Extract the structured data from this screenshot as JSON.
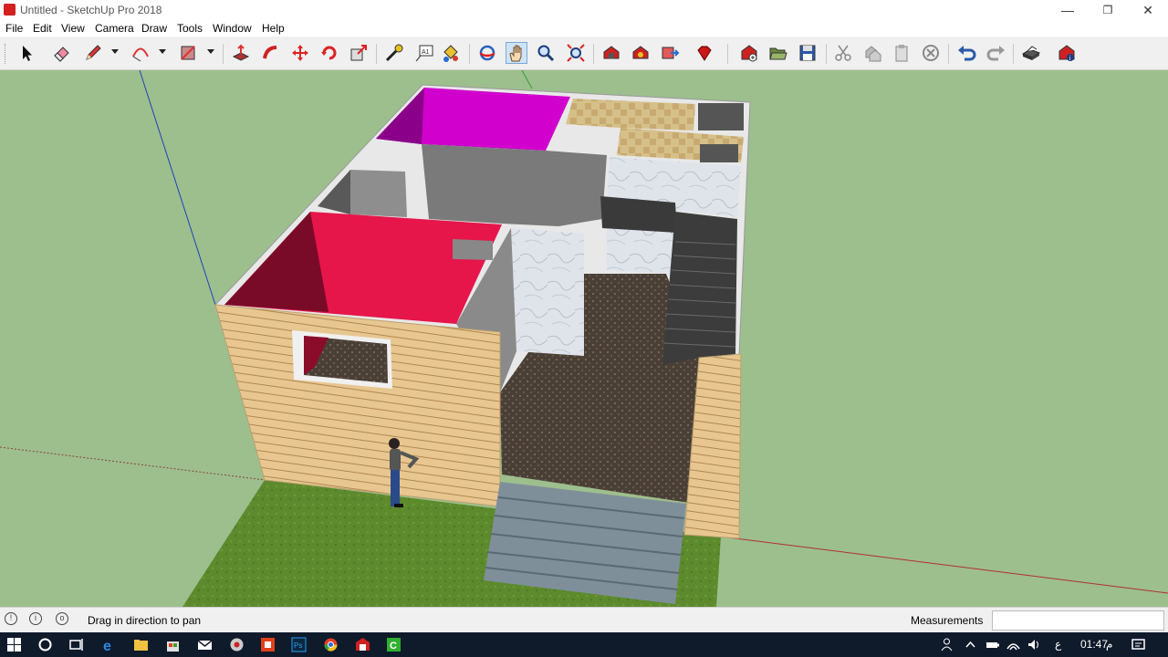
{
  "window": {
    "title": "Untitled - SketchUp Pro 2018",
    "controls": {
      "minimize": "—",
      "maximize": "❐",
      "close": "✕"
    }
  },
  "menu": [
    "File",
    "Edit",
    "View",
    "Camera",
    "Draw",
    "Tools",
    "Window",
    "Help"
  ],
  "toolbar": {
    "tools": [
      {
        "name": "select-tool",
        "icon": "cursor-arrow-icon"
      },
      {
        "name": "eraser-tool",
        "icon": "eraser-icon"
      },
      {
        "name": "line-tool",
        "icon": "pencil-icon"
      },
      {
        "name": "arc-tool",
        "icon": "arc-icon"
      },
      {
        "name": "rectangle-tool",
        "icon": "rectangle-icon"
      },
      {
        "name": "push-pull-tool",
        "icon": "push-pull-icon"
      },
      {
        "name": "follow-me-tool",
        "icon": "follow-me-icon"
      },
      {
        "name": "move-tool",
        "icon": "move-arrows-icon"
      },
      {
        "name": "rotate-tool",
        "icon": "rotate-icon"
      },
      {
        "name": "scale-tool",
        "icon": "scale-icon"
      },
      {
        "name": "tape-measure-tool",
        "icon": "tape-measure-icon"
      },
      {
        "name": "text-tool",
        "icon": "text-icon"
      },
      {
        "name": "paint-bucket-tool",
        "icon": "paint-bucket-icon"
      },
      {
        "name": "orbit-tool",
        "icon": "orbit-icon"
      },
      {
        "name": "pan-tool",
        "icon": "hand-pan-icon"
      },
      {
        "name": "zoom-tool",
        "icon": "magnifier-icon"
      },
      {
        "name": "zoom-extents-tool",
        "icon": "zoom-extents-icon"
      },
      {
        "name": "3d-warehouse",
        "icon": "warehouse-icon"
      },
      {
        "name": "extension-warehouse",
        "icon": "extension-icon"
      },
      {
        "name": "share-model",
        "icon": "share-model-icon"
      },
      {
        "name": "ruby-console",
        "icon": "ruby-gem-icon"
      },
      {
        "name": "new-file",
        "icon": "new-file-icon"
      },
      {
        "name": "open-file",
        "icon": "folder-open-icon"
      },
      {
        "name": "save-file",
        "icon": "save-disk-icon"
      },
      {
        "name": "cut",
        "icon": "scissors-icon"
      },
      {
        "name": "copy",
        "icon": "copy-icon"
      },
      {
        "name": "paste",
        "icon": "paste-icon"
      },
      {
        "name": "delete",
        "icon": "delete-circle-icon"
      },
      {
        "name": "undo",
        "icon": "undo-arrow-icon"
      },
      {
        "name": "redo",
        "icon": "redo-arrow-icon"
      },
      {
        "name": "print",
        "icon": "printer-icon"
      },
      {
        "name": "model-info",
        "icon": "model-info-icon"
      }
    ]
  },
  "status": {
    "message": "Drag in direction to pan",
    "measurements_label": "Measurements",
    "measurements_value": ""
  },
  "taskbar": {
    "time": "01:47",
    "time_suffix": "م",
    "lang": "ع",
    "apps": [
      "start-icon",
      "cortana-icon",
      "task-view-icon",
      "edge-icon",
      "file-explorer-icon",
      "mail-icon",
      "app-icon",
      "sketchup-red-icon",
      "photoshop-icon",
      "chrome-icon",
      "sketchup-icon",
      "green-app-icon"
    ]
  },
  "colors": {
    "sky_background": "#9dbf8d",
    "grass": "#5c8a2e",
    "wall_siding": "#e6c48a",
    "room_magenta": "#d400d0",
    "room_red": "#e8184a",
    "floor_carpet": "#4a4038",
    "stairs": "#444444",
    "front_steps": "#7a8a96"
  }
}
